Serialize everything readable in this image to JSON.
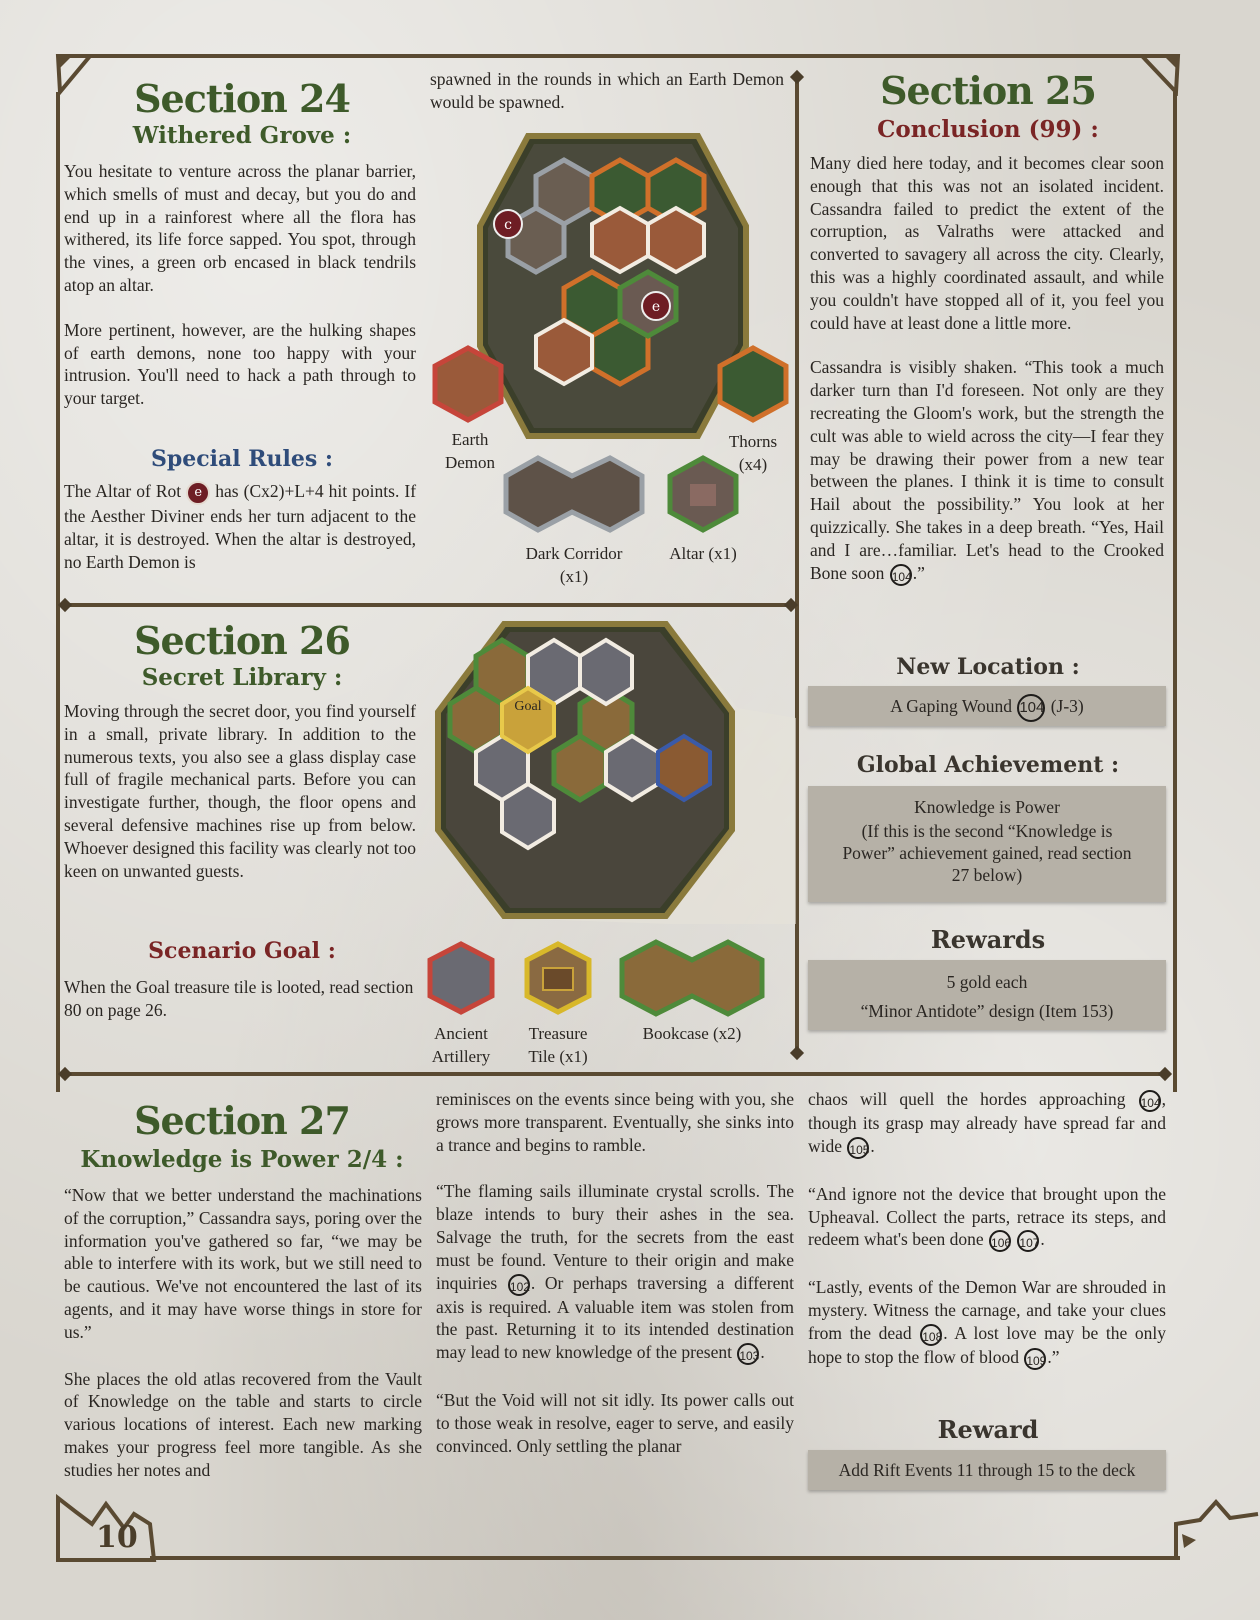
{
  "page_number": "10",
  "section24": {
    "title": "Section 24",
    "subtitle": "Withered Grove :",
    "intro1": "You hesitate to venture across the planar barrier, which smells of must and decay, but you do and end up in a rainforest where all the flora has withered, its life force sapped. You spot, through the vines, a green orb encased in black tendrils atop an altar.",
    "intro2": "More pertinent, however, are the hulking shapes of earth demons, none too happy with your intrusion. You'll need to hack a path through to your target.",
    "special_rules_heading": "Special Rules :",
    "rule_a": "The Altar of Rot",
    "rule_icon": "e",
    "rule_b": "has (Cx2)+L+4 hit points. If the Aesther Diviner ends her turn adjacent to the altar, it is destroyed. When the altar is destroyed, no Earth Demon is",
    "rule_cont": "spawned in the rounds in which an Earth Demon would be spawned.",
    "map_markers": {
      "c": "c",
      "e": "e"
    },
    "legend": {
      "earth_demon": "Earth Demon",
      "thorns": "Thorns (x4)",
      "dark_corridor": "Dark Corridor (x1)",
      "altar": "Altar (x1)"
    }
  },
  "section25": {
    "title": "Section 25",
    "subtitle": "Conclusion (99) :",
    "p1": "Many died here today, and it becomes clear soon enough that this was not an isolated incident. Cassandra failed to predict the extent of the corruption, as Valraths were attacked and converted to savagery all across the city. Clearly, this was a highly coordinated assault, and while you couldn't have stopped all of it, you feel you could have at least done a little more.",
    "p2": "Cassandra is visibly shaken. “This took a much darker turn than I'd foreseen. Not only are they recreating the Gloom's work, but the strength the cult was able to wield across the city—I fear they may be drawing their power from a new tear between the planes. I think it is time to consult Hail about the possibility.” You look at her quizzically. She takes in a deep breath. “Yes, Hail and I are…familiar. Let's head to the Crooked Bone soon",
    "p2_ref": "104",
    "p2_end": ".”",
    "new_location_heading": "New Location :",
    "new_location_a": "A Gaping Wound",
    "new_location_ref": "104",
    "new_location_b": "(J-3)",
    "achievement_heading": "Global Achievement :",
    "achievement_name": "Knowledge is Power",
    "achievement_note": "(If this is the second “Knowledge is Power” achievement gained, read section 27 below)",
    "rewards_heading": "Rewards",
    "reward1": "5 gold each",
    "reward2": "“Minor Antidote” design (Item 153)"
  },
  "section26": {
    "title": "Section 26",
    "subtitle": "Secret Library :",
    "p1": "Moving through the secret door, you find yourself in a small, private library. In addition to the numerous texts, you also see a glass display case full of fragile mechanical parts. Before you can investigate further, though, the floor opens and several defensive machines rise up from below. Whoever designed this facility was clearly not too keen on unwanted guests.",
    "goal_heading": "Scenario Goal :",
    "goal_text": "When the Goal treasure tile is looted, read section 80 on page 26.",
    "map_goal_label": "Goal",
    "legend": {
      "artillery": "Ancient Artillery",
      "treasure": "Treasure Tile (x1)",
      "bookcase": "Bookcase (x2)"
    }
  },
  "section27": {
    "title": "Section 27",
    "subtitle": "Knowledge is Power 2/4 :",
    "c1p1": "“Now that we better understand the machinations of the corruption,” Cassandra says, poring over the information you've gathered so far, “we may be able to interfere with its work, but we still need to be cautious. We've not encountered the last of its agents, and it may have worse things in store for us.”",
    "c1p2": "She places the old atlas recovered from the Vault of Knowledge on the table and starts to circle various locations of interest. Each new marking makes your progress feel more tangible. As she studies her notes and",
    "c2p1": "reminisces on the events since being with you, she grows more transparent. Eventually, she sinks into a trance and begins to ramble.",
    "c2p2a": "“The flaming sails illuminate crystal scrolls. The blaze intends to bury their ashes in the sea. Salvage the truth, for the secrets from the east must be found. Venture to their origin and make inquiries",
    "c2p2_ref1": "102",
    "c2p2b": ". Or perhaps traversing a different axis is required. A valuable item was stolen from the past. Returning it to its intended destination may lead to new knowledge of the present",
    "c2p2_ref2": "103",
    "c2p2c": ".",
    "c2p3": "“But the Void will not sit idly. Its power calls out to those weak in resolve, eager to serve, and easily convinced. Only settling the planar",
    "c3p1a": "chaos will quell the hordes approaching",
    "c3p1_ref1": "104",
    "c3p1b": ", though its grasp may already have spread far and wide",
    "c3p1_ref2": "105",
    "c3p1c": ".",
    "c3p2a": "“And ignore not the device that brought upon the Upheaval. Collect the parts, retrace its steps, and redeem what's been done",
    "c3p2_ref1": "106",
    "c3p2_ref2": "107",
    "c3p2b": ".",
    "c3p3a": "“Lastly, events of the Demon War are shrouded in mystery. Witness the carnage, and take your clues from the dead",
    "c3p3_ref1": "108",
    "c3p3b": ". A lost love may be the only hope to stop the flow of blood",
    "c3p3_ref2": "109",
    "c3p3c": ".”",
    "reward_heading": "Reward",
    "reward_text": "Add Rift Events 11 through 15 to the deck"
  }
}
